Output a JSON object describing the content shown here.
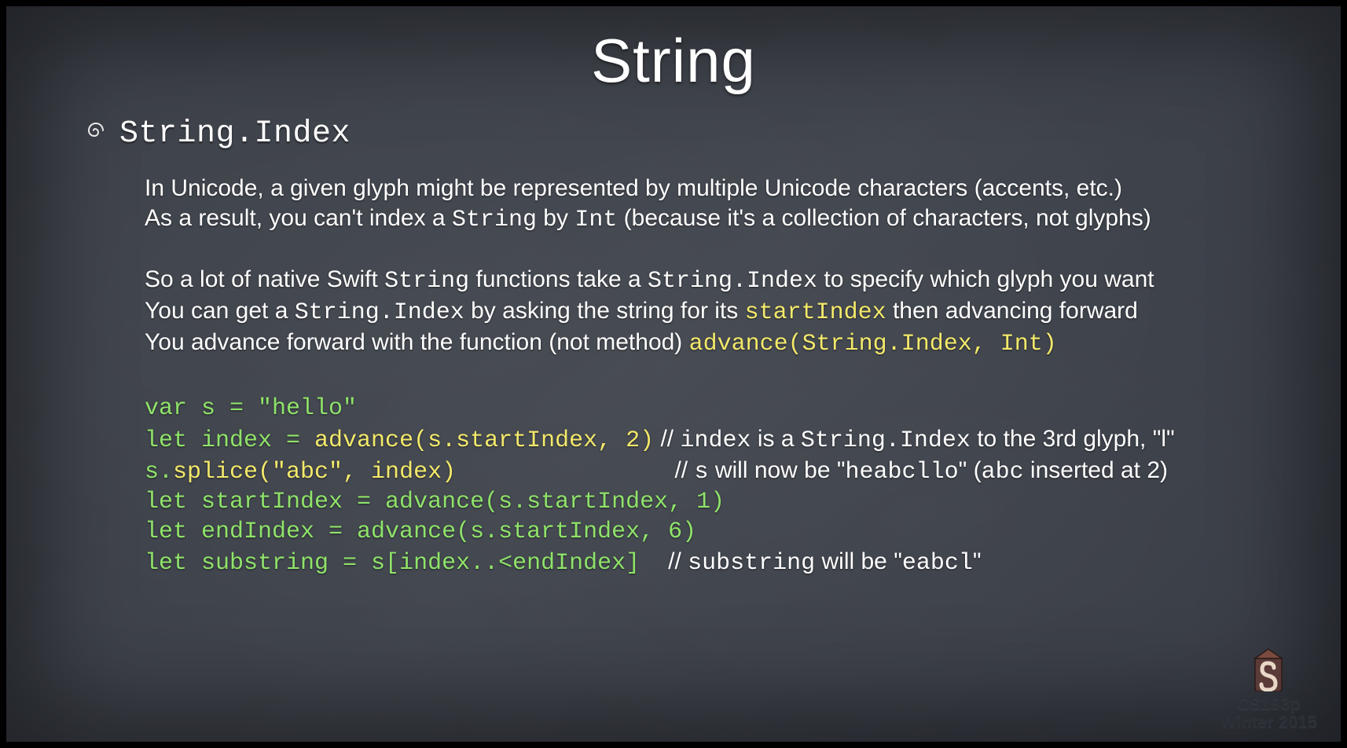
{
  "slide": {
    "title": "String",
    "subtitle": "String.Index",
    "para1_line1_pre": "In Unicode, a given glyph might be represented by multiple Unicode characters (accents, etc.)",
    "para1_line2_a": "As a result, you can't index a ",
    "para1_line2_mono1": "String",
    "para1_line2_b": " by ",
    "para1_line2_mono2": "Int",
    "para1_line2_c": " (because it's a collection of characters, not glyphs)",
    "para2_line1_a": "So a lot of native Swift ",
    "para2_line1_mono1": "String",
    "para2_line1_b": " functions take a ",
    "para2_line1_mono2": "String.Index",
    "para2_line1_c": " to specify which glyph you want",
    "para2_line2_a": "You can get a ",
    "para2_line2_mono1": "String.Index",
    "para2_line2_b": " by asking the string for its ",
    "para2_line2_kw": "startIndex",
    "para2_line2_c": " then advancing forward",
    "para2_line3_a": "You advance forward with the function (not method) ",
    "para2_line3_kw": "advance(String.Index, Int)",
    "code": {
      "l1_var": "var",
      "l1_rest": " s = \"hello\"",
      "l2_let": "let",
      "l2_a": " index = ",
      "l2_call": "advance(s.startIndex, 2)",
      "l2_cmt_pre": " // ",
      "l2_cmt_a": "index",
      "l2_cmt_b": " is a ",
      "l2_cmt_c": "String.Index",
      "l2_cmt_d": " to the 3rd glyph, \"l\"",
      "l3_a": "s.",
      "l3_call": "splice(\"abc\", index)",
      "l3_pad": "               ",
      "l3_cmt_pre": " // ",
      "l3_cmt_a": "s",
      "l3_cmt_b": " will now be \"",
      "l3_cmt_c": "heabcllo",
      "l3_cmt_d": "\" (",
      "l3_cmt_e": "abc",
      "l3_cmt_f": " inserted at 2)",
      "l4_let": "let",
      "l4_rest": " startIndex = advance(s.startIndex, 1)",
      "l5_let": "let",
      "l5_rest": " endIndex = advance(s.startIndex, 6)",
      "l6_let": "let",
      "l6_rest": " substring = s[index..<endIndex]  ",
      "l6_cmt_pre": "// ",
      "l6_cmt_a": "substring",
      "l6_cmt_b": " will be \"",
      "l6_cmt_c": "eabcl",
      "l6_cmt_d": "\""
    }
  },
  "footer": {
    "course": "CS193p",
    "term": "Winter 2015"
  }
}
